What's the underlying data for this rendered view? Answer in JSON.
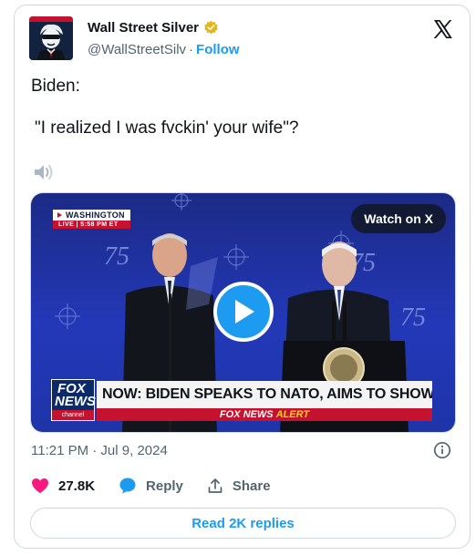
{
  "author": {
    "display_name": "Wall Street Silver",
    "handle": "@WallStreetSilv",
    "separator": "·",
    "follow_label": "Follow"
  },
  "tweet": {
    "text": "Biden:",
    "quote": "\"I realized I was fvckin' your wife\"?"
  },
  "media": {
    "watch_label": "Watch on X",
    "location": "WASHINGTON",
    "live_time": "LIVE | 5:58 PM ET",
    "logo_fox": "FOX",
    "logo_news": "NEWS",
    "logo_channel": "channel",
    "chyron": "NOW: BIDEN SPEAKS TO NATO, AIMS TO SHOW FITNESS",
    "alert_prefix": "FOX NEWS",
    "alert_word": "ALERT"
  },
  "timestamp": "11:21 PM · Jul 9, 2024",
  "actions": {
    "likes": "27.8K",
    "reply_label": "Reply",
    "share_label": "Share"
  },
  "read_replies_label": "Read 2K replies",
  "colors": {
    "accent": "#1d9bf0",
    "like": "#f91880",
    "verified": "#e2b719",
    "fox_red": "#c4122f",
    "fox_blue": "#0b2a6b"
  },
  "icons": [
    "avatar",
    "verified-badge-icon",
    "x-logo-icon",
    "speaker-icon",
    "play-icon",
    "info-icon",
    "heart-icon",
    "reply-bubble-icon",
    "share-icon"
  ]
}
